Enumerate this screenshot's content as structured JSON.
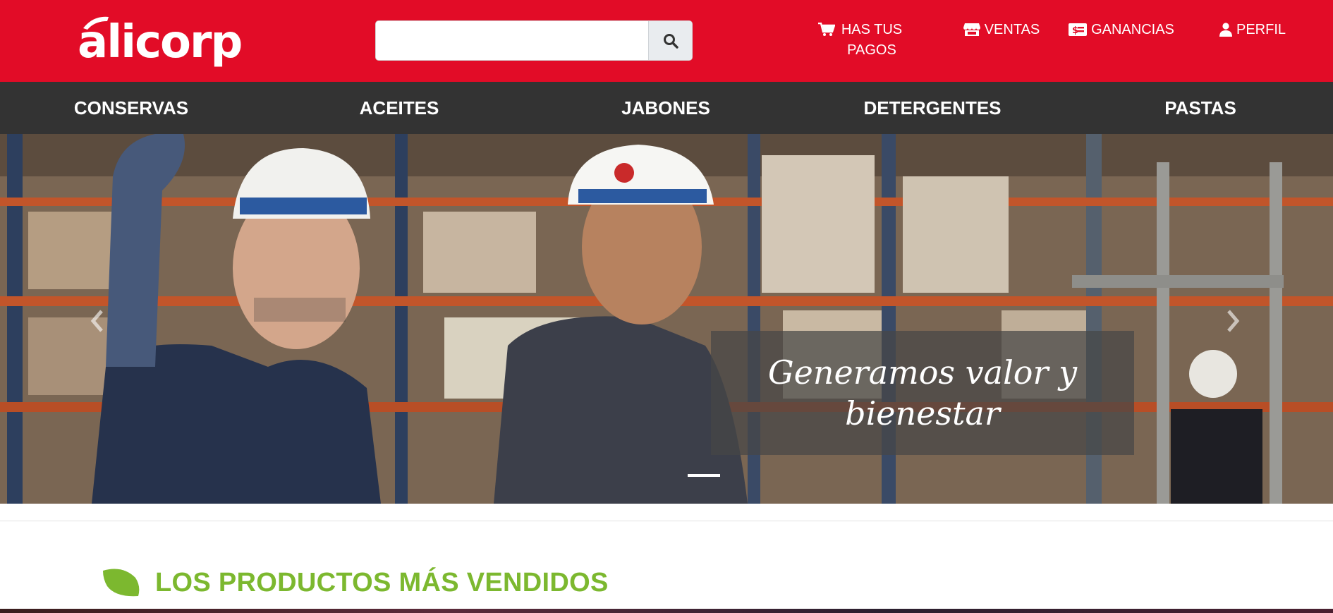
{
  "header": {
    "logo_text": "alicorp",
    "search": {
      "value": "",
      "placeholder": ""
    },
    "nav": [
      {
        "label": "HAS TUS PAGOS",
        "icon": "shopping-cart-icon"
      },
      {
        "label": "VENTAS",
        "icon": "store-icon"
      },
      {
        "label": "GANANCIAS",
        "icon": "money-bill-icon"
      },
      {
        "label": "PERFIL",
        "icon": "user-icon"
      }
    ]
  },
  "categories": [
    "CONSERVAS",
    "ACEITES",
    "JABONES",
    "DETERGENTES",
    "PASTAS"
  ],
  "carousel": {
    "caption": "Generamos valor y bienestar",
    "active_slide": 1
  },
  "section": {
    "title": "LOS PRODUCTOS MÁS VENDIDOS",
    "icon": "leaf-icon"
  },
  "colors": {
    "brand_red": "#e20c27",
    "nav_dark": "#333333",
    "accent_green": "#7cb82f"
  }
}
